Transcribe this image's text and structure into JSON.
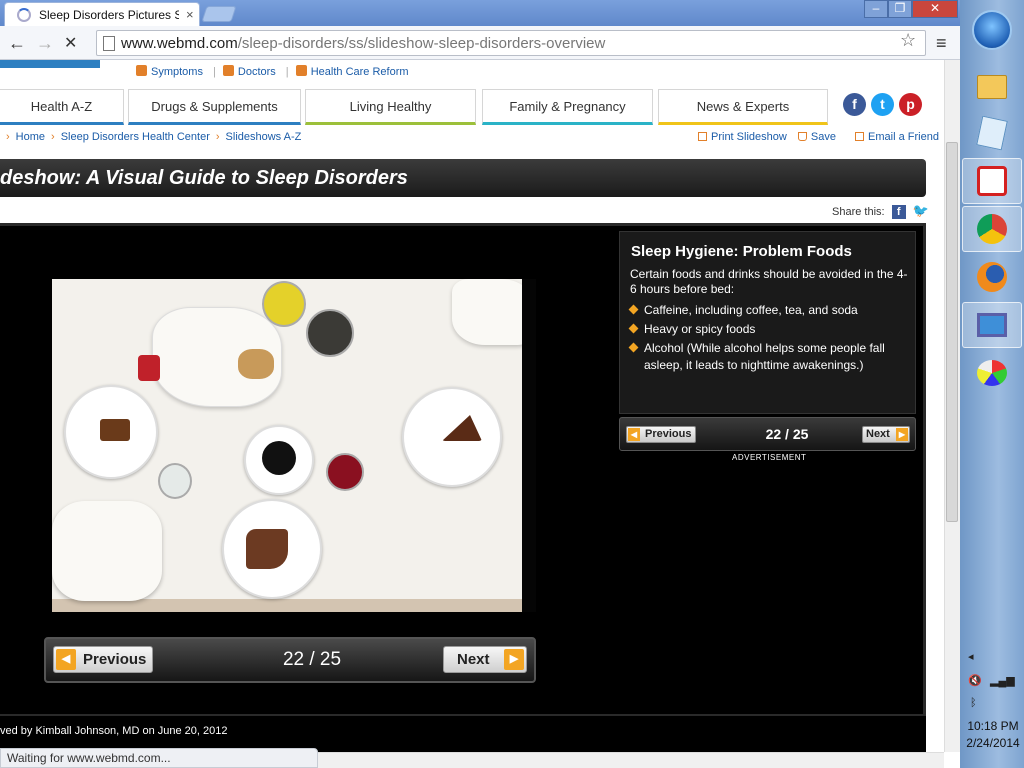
{
  "browser": {
    "tab_title": "Sleep Disorders Pictures Sl",
    "tab_close": "×",
    "url_domain": "www.webmd.com",
    "url_path": "/sleep-disorders/ss/slideshow-sleep-disorders-overview",
    "status_text": "Waiting for www.webmd.com...",
    "back": "←",
    "forward": "→",
    "stop": "✕",
    "star": "☆",
    "menu": "≡",
    "win_min": "–",
    "win_max": "❐",
    "win_close": "✕"
  },
  "header": {
    "top_links": [
      "Symptoms",
      "Doctors",
      "Health Care Reform"
    ],
    "nav_tabs": [
      {
        "label": "Health A-Z",
        "color": "#2d7fc1"
      },
      {
        "label": "Drugs & Supplements",
        "color": "#2d7fc1"
      },
      {
        "label": "Living Healthy",
        "color": "#9cc03a"
      },
      {
        "label": "Family & Pregnancy",
        "color": "#2ab3c7"
      },
      {
        "label": "News & Experts",
        "color": "#f0c419"
      }
    ],
    "social": {
      "facebook": "f",
      "twitter": "t",
      "pinterest": "p"
    }
  },
  "breadcrumb": [
    "Home",
    "Sleep Disorders Health Center",
    "Slideshows A-Z"
  ],
  "actions": {
    "print": "Print Slideshow",
    "save": "Save",
    "email": "Email a Friend"
  },
  "page_title": "deshow: A Visual Guide to Sleep Disorders",
  "share_label": "Share this:",
  "slide": {
    "heading": "Sleep Hygiene: Problem Foods",
    "intro": "Certain foods and drinks should be avoided in the 4-6 hours before bed:",
    "bullets": [
      "Caffeine, including coffee, tea, and soda",
      "Heavy or spicy foods",
      "Alcohol (While alcohol helps some people fall asleep, it leads to nighttime awakenings.)"
    ],
    "counter": "22 / 25",
    "previous": "Previous",
    "next": "Next",
    "advertisement": "ADVERTISEMENT"
  },
  "reviewed": "ved by Kimball Johnson, MD on June 20, 2012",
  "taskbar": {
    "time": "10:18 PM",
    "date": "2/24/2014"
  }
}
